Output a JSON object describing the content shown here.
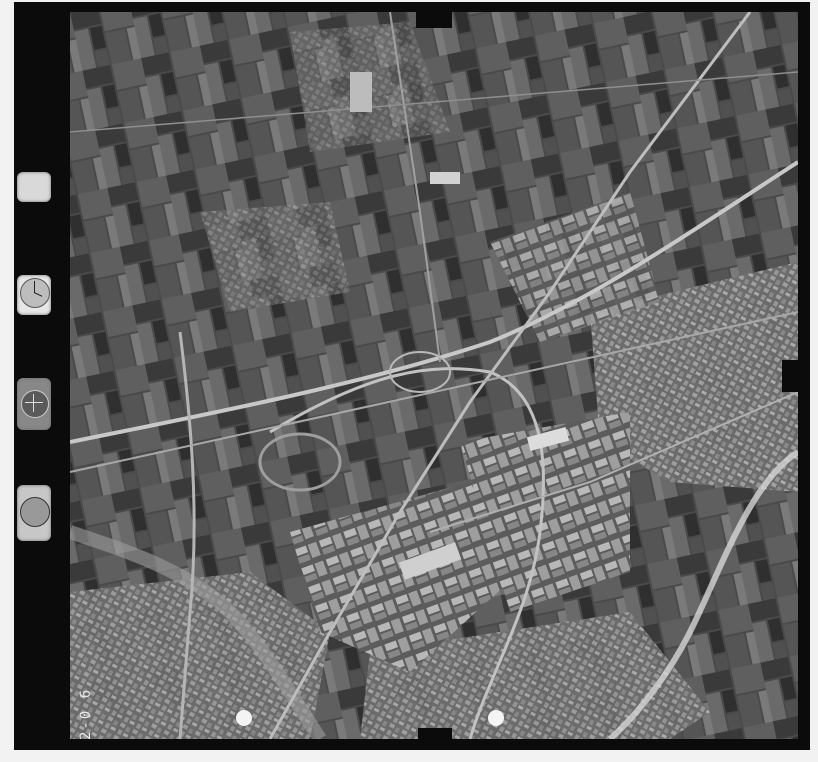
{
  "image": {
    "type": "aerial-photograph",
    "tone": "grayscale"
  },
  "margin_annotations": {
    "frame_number": "2-0 6"
  },
  "colors": {
    "frame": "#0b0b0b",
    "paper": "#f2f2f2",
    "fields_dark": "#3a3a3a",
    "fields_light": "#8a8a8a",
    "urban": "#9a9a9a",
    "roads": "#c8c8c8",
    "river": "#d6d6d6"
  },
  "instruments": [
    {
      "name": "date-plate"
    },
    {
      "name": "clock"
    },
    {
      "name": "altimeter-level"
    },
    {
      "name": "counter-dial"
    }
  ]
}
